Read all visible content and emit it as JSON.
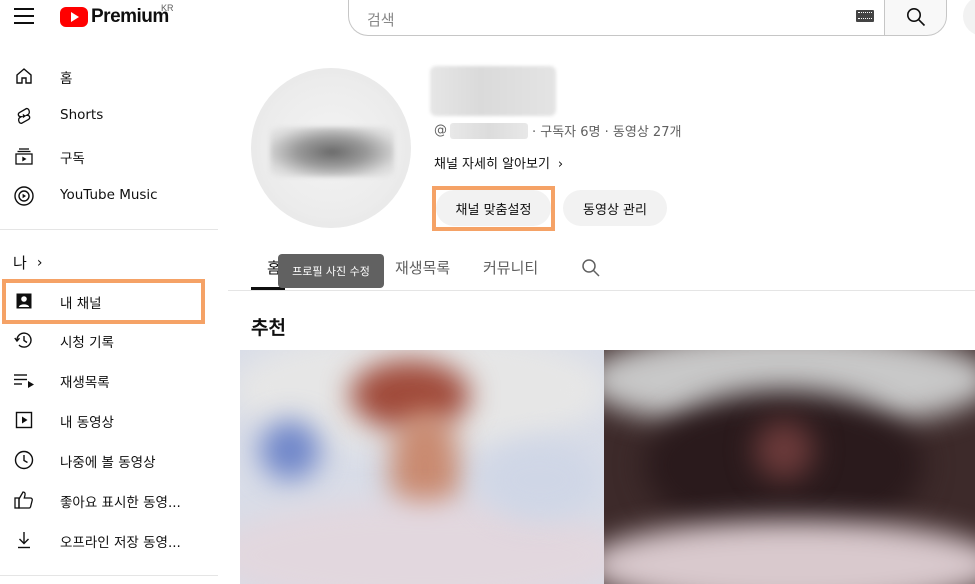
{
  "header": {
    "logo_text": "Premium",
    "region": "KR",
    "search_placeholder": "검색"
  },
  "sidebar": {
    "main_items": [
      {
        "label": "홈",
        "icon": "home-icon"
      },
      {
        "label": "Shorts",
        "icon": "shorts-icon"
      },
      {
        "label": "구독",
        "icon": "subscriptions-icon"
      },
      {
        "label": "YouTube Music",
        "icon": "youtube-music-icon"
      }
    ],
    "me_label": "나",
    "me_items": [
      {
        "label": "내 채널",
        "icon": "your-channel-icon"
      },
      {
        "label": "시청 기록",
        "icon": "history-icon"
      },
      {
        "label": "재생목록",
        "icon": "playlists-icon"
      },
      {
        "label": "내 동영상",
        "icon": "your-videos-icon"
      },
      {
        "label": "나중에 볼 동영상",
        "icon": "watch-later-icon"
      },
      {
        "label": "좋아요 표시한 동영...",
        "icon": "liked-videos-icon"
      },
      {
        "label": "오프라인 저장 동영...",
        "icon": "downloads-icon"
      }
    ]
  },
  "channel": {
    "handle_prefix": "@",
    "stats": "· 구독자 6명 · 동영상 27개",
    "more_link": "채널 자세히 알아보기",
    "customize_button": "채널 맞춤설정",
    "manage_videos_button": "동영상 관리"
  },
  "tabs": {
    "home_visible": "홈",
    "playlists": "재생목록",
    "community": "커뮤니티"
  },
  "tooltip": "프로필 사진 수정",
  "section_title": "추천",
  "colors": {
    "highlight": "#f5a266",
    "brand_red": "#ff0000"
  }
}
